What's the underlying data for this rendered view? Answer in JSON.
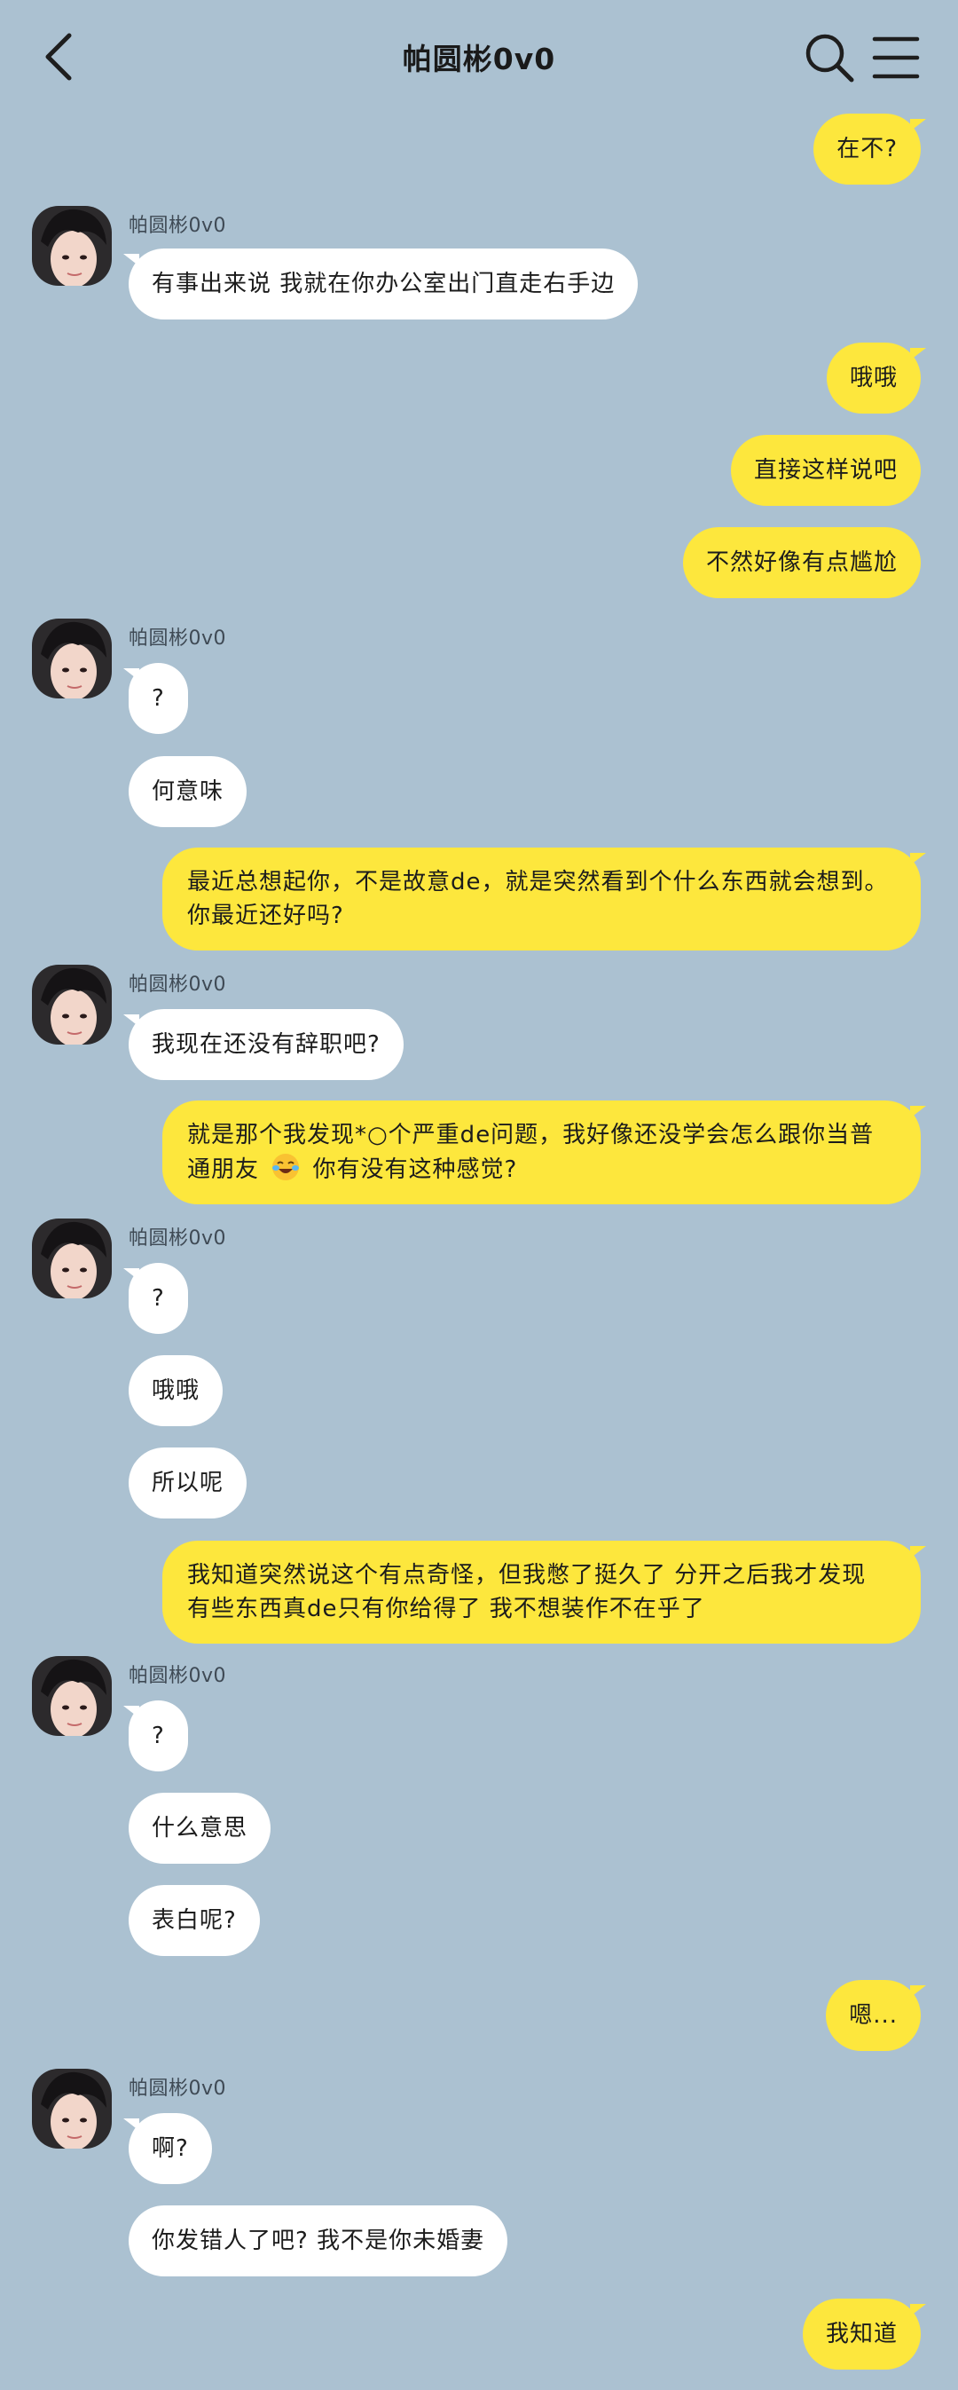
{
  "header": {
    "title": "帕圆彬0v0"
  },
  "contact_name": "帕圆彬0v0",
  "messages": {
    "m1": "在不?",
    "m2": "有事出来说 我就在你办公室出门直走右手边",
    "m3": "哦哦",
    "m4": "直接这样说吧",
    "m5": "不然好像有点尴尬",
    "m6": "?",
    "m7": "何意味",
    "m8": "最近总想起你，不是故意de，就是突然看到个什么东西就会想到。你最近还好吗?",
    "m9": "我现在还没有辞职吧?",
    "m10a": "就是那个我发现*○个严重de问题，我好像还没学会怎么跟你当普通朋友",
    "m10b": "你有没有这种感觉?",
    "m11": "?",
    "m12": "哦哦",
    "m13": "所以呢",
    "m14": "我知道突然说这个有点奇怪，但我憋了挺久了 分开之后我才发现 有些东西真de只有你给得了 我不想装作不在乎了",
    "m15": "?",
    "m16": "什么意思",
    "m17": "表白呢?",
    "m18": "嗯...",
    "m19": "啊?",
    "m20": "你发错人了吧? 我不是你未婚妻",
    "m21": "我知道"
  },
  "colors": {
    "background": "#abc1d1",
    "my_bubble": "#fde73d",
    "their_bubble": "#ffffff"
  },
  "icons": [
    "back-arrow-icon",
    "search-icon",
    "menu-icon",
    "crying-laughing-emoji-icon"
  ]
}
